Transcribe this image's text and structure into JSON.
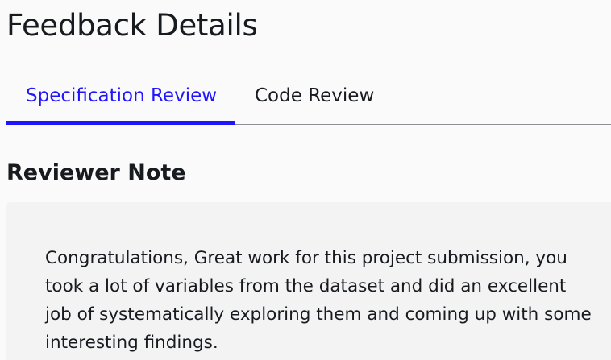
{
  "page": {
    "title": "Feedback Details"
  },
  "tabs": [
    {
      "label": "Specification Review",
      "active": true
    },
    {
      "label": "Code Review",
      "active": false
    }
  ],
  "theme": {
    "accent": "#2015ff",
    "text": "#171a1f",
    "background": "#fafafa",
    "note_background": "#f3f3f3"
  },
  "reviewer_note": {
    "heading": "Reviewer Note",
    "body": "Congratulations, Great work for this project submission, you took a lot of variables from the dataset and did an excellent job of systematically exploring them and coming up with some interesting findings."
  }
}
